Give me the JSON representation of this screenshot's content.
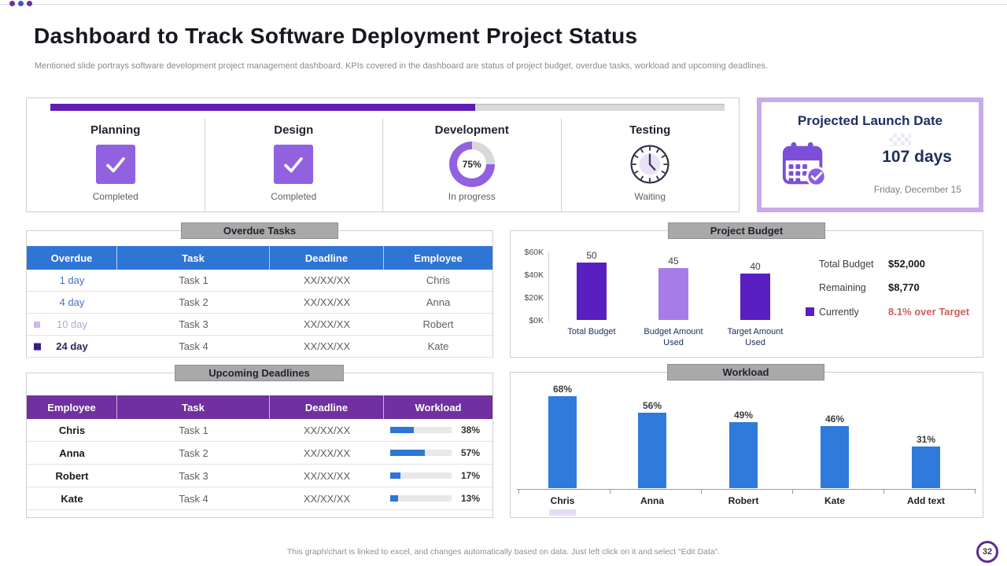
{
  "slide": {
    "title": "Dashboard to Track Software Deployment Project Status",
    "subtitle": "Mentioned slide portrays software development project management dashboard. KPIs covered in the dashboard are status of project budget, overdue tasks, workload and upcoming deadlines.",
    "footer_note": "This graph/chart is linked to excel,  and changes automatically based on data. Just left click on it and select “Edit Data”.",
    "page_number": "32"
  },
  "phases": {
    "progress_percent": 63,
    "items": [
      {
        "name": "Planning",
        "status": "Completed",
        "icon": "check-icon"
      },
      {
        "name": "Design",
        "status": "Completed",
        "icon": "check-icon"
      },
      {
        "name": "Development",
        "status": "In progress",
        "icon": "donut-progress",
        "percent_label": "75%",
        "percent_value": 75
      },
      {
        "name": "Testing",
        "status": "Waiting",
        "icon": "clock-icon"
      }
    ]
  },
  "launch": {
    "title": "Projected Launch Date",
    "days": "107 days",
    "date": "Friday, December 15",
    "icon": "calendar-check-icon"
  },
  "overdue_tasks": {
    "title": "Overdue Tasks",
    "headers": [
      "Overdue",
      "Task",
      "Deadline",
      "Employee"
    ],
    "rows": [
      {
        "overdue": "1 day",
        "task": "Task 1",
        "deadline": "XX/XX/XX",
        "employee": "Chris"
      },
      {
        "overdue": "4 day",
        "task": "Task 2",
        "deadline": "XX/XX/XX",
        "employee": "Anna"
      },
      {
        "overdue": "10 day",
        "task": "Task 3",
        "deadline": "XX/XX/XX",
        "employee": "Robert"
      },
      {
        "overdue": "24 day",
        "task": "Task 4",
        "deadline": "XX/XX/XX",
        "employee": "Kate"
      }
    ]
  },
  "budget": {
    "title": "Project Budget",
    "stats": [
      {
        "label": "Total Budget",
        "value": "$52,000"
      },
      {
        "label": "Remaining",
        "value": "$8,770"
      },
      {
        "label": "Currently",
        "value": "8.1%  over Target"
      }
    ]
  },
  "deadlines": {
    "title": "Upcoming Deadlines",
    "headers": [
      "Employee",
      "Task",
      "Deadline",
      "Workload"
    ],
    "rows": [
      {
        "employee": "Chris",
        "task": "Task 1",
        "deadline": "XX/XX/XX",
        "workload_pct": 38,
        "workload_label": "38%"
      },
      {
        "employee": "Anna",
        "task": "Task 2",
        "deadline": "XX/XX/XX",
        "workload_pct": 57,
        "workload_label": "57%"
      },
      {
        "employee": "Robert",
        "task": "Task 3",
        "deadline": "XX/XX/XX",
        "workload_pct": 17,
        "workload_label": "17%"
      },
      {
        "employee": "Kate",
        "task": "Task 4",
        "deadline": "XX/XX/XX",
        "workload_pct": 13,
        "workload_label": "13%"
      }
    ]
  },
  "workload": {
    "title": "Workload"
  },
  "chart_data": [
    {
      "id": "project_budget",
      "type": "bar",
      "title": "Project Budget",
      "categories": [
        "Total Budget",
        "Budget Amount Used",
        "Target Amount Used"
      ],
      "values": [
        50,
        45,
        40
      ],
      "unit": "thousand dollars",
      "ytick_labels": [
        "$0K",
        "$20K",
        "$40K",
        "$60K"
      ],
      "ylim": [
        0,
        60
      ],
      "grid": false,
      "legend_position": "right",
      "bar_colors": [
        "#5a1fc0",
        "#a87ce8",
        "#5a1fc0"
      ],
      "annotations": [
        "Total Budget $52,000",
        "Remaining $8,770",
        "Currently 8.1% over Target"
      ]
    },
    {
      "id": "workload",
      "type": "bar",
      "title": "Workload",
      "categories": [
        "Chris",
        "Anna",
        "Robert",
        "Kate",
        "Add text"
      ],
      "values": [
        68,
        56,
        49,
        46,
        31
      ],
      "value_labels": [
        "68%",
        "56%",
        "49%",
        "46%",
        "31%"
      ],
      "ylim": [
        0,
        100
      ],
      "grid": false,
      "bar_color": "#2e7bdb"
    }
  ],
  "colors": {
    "accent_violet": "#5a1fc0",
    "light_violet": "#a87ce8",
    "tile_purple": "#9161e0",
    "table_header_blue": "#2e75d6",
    "table_header_purple": "#7030a0",
    "chart_blue": "#2e7bdb",
    "navy": "#1e3060",
    "alert_red": "#c9605e",
    "tab_gray": "#a9a9a9",
    "launch_border": "#c7abea"
  }
}
